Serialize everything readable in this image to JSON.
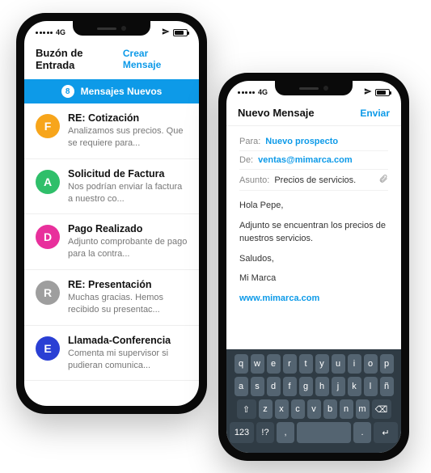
{
  "status": {
    "carrier": "4G"
  },
  "phone1": {
    "header_title": "Buzón de Entrada",
    "header_action": "Crear Mensaje",
    "banner_count": "8",
    "banner_text": "Mensajes Nuevos",
    "messages": [
      {
        "initial": "F",
        "color": "#f7a51b",
        "subject": "RE: Cotización",
        "preview": "Analizamos sus precios. Que se requiere para..."
      },
      {
        "initial": "A",
        "color": "#2fbf6a",
        "subject": "Solicitud de Factura",
        "preview": "Nos podrían enviar la factura a nuestro co..."
      },
      {
        "initial": "D",
        "color": "#e8309c",
        "subject": "Pago Realizado",
        "preview": "Adjunto comprobante de pago para la contra..."
      },
      {
        "initial": "R",
        "color": "#9e9e9e",
        "subject": "RE: Presentación",
        "preview": "Muchas gracias. Hemos recibido su presentac..."
      },
      {
        "initial": "E",
        "color": "#2a3fd4",
        "subject": "Llamada-Conferencia",
        "preview": "Comenta mi supervisor si pudieran comunica..."
      }
    ]
  },
  "phone2": {
    "header_title": "Nuevo Mensaje",
    "header_action": "Enviar",
    "to_label": "Para:",
    "to_value": "Nuevo prospecto",
    "from_label": "De:",
    "from_value": "ventas@mimarca.com",
    "subject_label": "Asunto:",
    "subject_value": "Precios de servicios.",
    "body_greeting": "Hola Pepe,",
    "body_line": "Adjunto se encuentran los precios de nuestros servicios.",
    "body_sign": "Saludos,",
    "body_brand": "Mi Marca",
    "body_url": "www.mimarca.com"
  },
  "keyboard": {
    "r1": [
      "q",
      "w",
      "e",
      "r",
      "t",
      "y",
      "u",
      "i",
      "o",
      "p"
    ],
    "r2": [
      "a",
      "s",
      "d",
      "f",
      "g",
      "h",
      "j",
      "k",
      "l",
      "ñ"
    ],
    "r3": [
      "⇧",
      "z",
      "x",
      "c",
      "v",
      "b",
      "n",
      "m",
      "⌫"
    ],
    "r4": [
      "123",
      "!?",
      ",",
      "space",
      ".",
      "↵"
    ]
  }
}
